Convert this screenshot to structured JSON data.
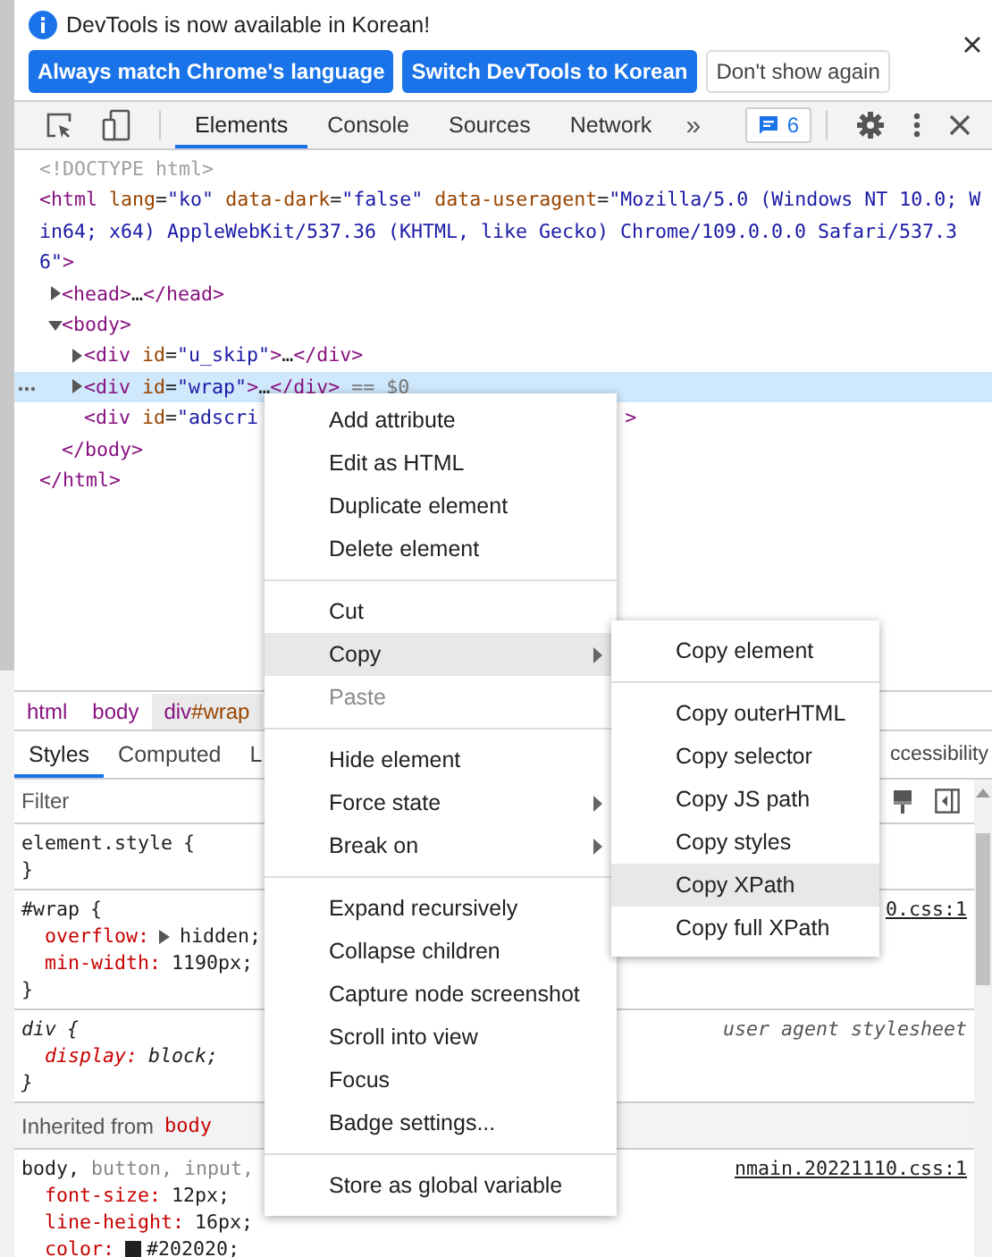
{
  "infobar": {
    "message": "DevTools is now available in Korean!",
    "buttons": [
      {
        "label": "Always match Chrome's language",
        "kind": "primary"
      },
      {
        "label": "Switch DevTools to Korean",
        "kind": "primary"
      },
      {
        "label": "Don't show again",
        "kind": "secondary"
      }
    ]
  },
  "toolbar": {
    "tabs": [
      {
        "label": "Elements",
        "selected": true
      },
      {
        "label": "Console",
        "selected": false
      },
      {
        "label": "Sources",
        "selected": false
      },
      {
        "label": "Network",
        "selected": false
      }
    ],
    "more": "»",
    "issues_count": "6"
  },
  "dom_tree": [
    {
      "open": [
        {
          "kind": "doctype",
          "text": "<!DOCTYPE html>"
        }
      ],
      "selected": false
    },
    {
      "open": [
        {
          "kind": "tag",
          "text": "<html"
        },
        {
          "kind": "attr",
          "text": " lang"
        },
        {
          "kind": "plain",
          "text": "="
        },
        {
          "kind": "value",
          "text": "\"ko\""
        },
        {
          "kind": "attr",
          "text": " data-dark"
        },
        {
          "kind": "plain",
          "text": "="
        },
        {
          "kind": "value",
          "text": "\"false\""
        },
        {
          "kind": "attr",
          "text": " data-useragent"
        },
        {
          "kind": "plain",
          "text": "="
        },
        {
          "kind": "value",
          "text": "\"Mozilla/5.0 (Windows NT 10.0; Win64; x64) AppleWebKit/537.36 (KHTML, like Gecko) Chrome/109.0.0.0 Safari/537.36\""
        },
        {
          "kind": "tag",
          "text": ">"
        }
      ],
      "selected": false,
      "children": [
        {
          "open": [
            {
              "kind": "tag",
              "text": "<head>"
            },
            {
              "kind": "plain",
              "text": "…"
            },
            {
              "kind": "tag",
              "text": "</head>"
            }
          ],
          "expanded": false,
          "selected": false
        },
        {
          "open": [
            {
              "kind": "tag",
              "text": "<body>"
            }
          ],
          "expanded": true,
          "selected": false,
          "children": [
            {
              "open": [
                {
                  "kind": "tag",
                  "text": "<div"
                },
                {
                  "kind": "attr",
                  "text": " id"
                },
                {
                  "kind": "plain",
                  "text": "="
                },
                {
                  "kind": "value",
                  "text": "\"u_skip\""
                },
                {
                  "kind": "tag",
                  "text": ">"
                },
                {
                  "kind": "plain",
                  "text": "…"
                },
                {
                  "kind": "tag",
                  "text": "</div>"
                }
              ],
              "expanded": false,
              "selected": false
            },
            {
              "open": [
                {
                  "kind": "tag",
                  "text": "<div"
                },
                {
                  "kind": "attr",
                  "text": " id"
                },
                {
                  "kind": "plain",
                  "text": "="
                },
                {
                  "kind": "value",
                  "text": "\"wrap\""
                },
                {
                  "kind": "tag",
                  "text": ">"
                },
                {
                  "kind": "plain",
                  "text": "…"
                },
                {
                  "kind": "tag",
                  "text": "</div>"
                },
                {
                  "kind": "muted",
                  "text": " == $0"
                }
              ],
              "expanded": false,
              "selected": true
            },
            {
              "open": [
                {
                  "kind": "tag",
                  "text": "<div"
                },
                {
                  "kind": "attr",
                  "text": " id"
                },
                {
                  "kind": "plain",
                  "text": "="
                },
                {
                  "kind": "value",
                  "text": "\"adscri"
                }
              ],
              "tail": [
                {
                  "kind": "tag",
                  "text": ">"
                }
              ],
              "selected": false
            }
          ],
          "close": [
            {
              "kind": "tag",
              "text": "</body>"
            }
          ]
        }
      ],
      "close": [
        {
          "kind": "tag",
          "text": "</html>"
        }
      ]
    }
  ],
  "breadcrumbs": [
    {
      "tag": "html",
      "selected": false
    },
    {
      "tag": "body",
      "selected": false
    },
    {
      "tag": "div",
      "id": "#wrap",
      "selected": true
    }
  ],
  "styles_pane": {
    "tabs": [
      {
        "label": "Styles",
        "selected": true
      },
      {
        "label": "Computed",
        "selected": false
      },
      {
        "label": "L",
        "selected": false
      },
      {
        "label": "ccessibility",
        "selected": false
      }
    ],
    "filter": {
      "placeholder": "Filter"
    },
    "rules": [
      {
        "kind": "inline",
        "selector": [
          {
            "text": "element.style",
            "matched": true
          }
        ],
        "open": "{",
        "close": "}"
      },
      {
        "kind": "author",
        "selector": [
          {
            "text": "#wrap",
            "matched": true
          }
        ],
        "open": "{",
        "source": "0.css:1",
        "properties": [
          {
            "name": "overflow:",
            "value": "hidden;",
            "expandable": true
          },
          {
            "name": "min-width:",
            "value": "1190px;"
          }
        ],
        "close": "}"
      },
      {
        "kind": "user_agent",
        "selector": [
          {
            "text": "div",
            "matched": true
          }
        ],
        "open": "{",
        "source": "user agent stylesheet",
        "properties": [
          {
            "name": "display:",
            "value": "block;"
          }
        ],
        "close": "}"
      },
      {
        "kind": "inherited_header",
        "label": "Inherited from",
        "element": "body"
      },
      {
        "kind": "author",
        "selector": [
          {
            "text": "body,",
            "matched": true
          },
          {
            "text": "button,",
            "matched": false
          },
          {
            "text": "input,",
            "matched": false
          }
        ],
        "source": "nmain.20221110.css:1",
        "properties": [
          {
            "name": "font-size:",
            "value": "12px;"
          },
          {
            "name": "line-height:",
            "value": "16px;"
          },
          {
            "name": "color:",
            "value": "#202020;",
            "color": "#202020"
          }
        ]
      }
    ]
  },
  "context_menu": {
    "items": [
      {
        "kind": "item",
        "label": "Add attribute",
        "submenu": false,
        "disabled": false,
        "selected": false
      },
      {
        "kind": "item",
        "label": "Edit as HTML",
        "submenu": false,
        "disabled": false,
        "selected": false
      },
      {
        "kind": "item",
        "label": "Duplicate element",
        "submenu": false,
        "disabled": false,
        "selected": false
      },
      {
        "kind": "item",
        "label": "Delete element",
        "submenu": false,
        "disabled": false,
        "selected": false
      },
      {
        "kind": "separator"
      },
      {
        "kind": "item",
        "label": "Cut",
        "submenu": false,
        "disabled": false,
        "selected": false
      },
      {
        "kind": "item",
        "label": "Copy",
        "submenu": true,
        "disabled": false,
        "selected": true
      },
      {
        "kind": "item",
        "label": "Paste",
        "submenu": false,
        "disabled": true,
        "selected": false
      },
      {
        "kind": "separator"
      },
      {
        "kind": "item",
        "label": "Hide element",
        "submenu": false,
        "disabled": false,
        "selected": false
      },
      {
        "kind": "item",
        "label": "Force state",
        "submenu": true,
        "disabled": false,
        "selected": false
      },
      {
        "kind": "item",
        "label": "Break on",
        "submenu": true,
        "disabled": false,
        "selected": false
      },
      {
        "kind": "separator"
      },
      {
        "kind": "item",
        "label": "Expand recursively",
        "submenu": false,
        "disabled": false,
        "selected": false
      },
      {
        "kind": "item",
        "label": "Collapse children",
        "submenu": false,
        "disabled": false,
        "selected": false
      },
      {
        "kind": "item",
        "label": "Capture node screenshot",
        "submenu": false,
        "disabled": false,
        "selected": false
      },
      {
        "kind": "item",
        "label": "Scroll into view",
        "submenu": false,
        "disabled": false,
        "selected": false
      },
      {
        "kind": "item",
        "label": "Focus",
        "submenu": false,
        "disabled": false,
        "selected": false
      },
      {
        "kind": "item",
        "label": "Badge settings...",
        "submenu": false,
        "disabled": false,
        "selected": false
      },
      {
        "kind": "separator"
      },
      {
        "kind": "item",
        "label": "Store as global variable",
        "submenu": false,
        "disabled": false,
        "selected": false
      }
    ]
  },
  "submenu": {
    "items": [
      {
        "kind": "item",
        "label": "Copy element",
        "disabled": false,
        "selected": false
      },
      {
        "kind": "separator"
      },
      {
        "kind": "item",
        "label": "Copy outerHTML",
        "disabled": false,
        "selected": false
      },
      {
        "kind": "item",
        "label": "Copy selector",
        "disabled": false,
        "selected": false
      },
      {
        "kind": "item",
        "label": "Copy JS path",
        "disabled": false,
        "selected": false
      },
      {
        "kind": "item",
        "label": "Copy styles",
        "disabled": false,
        "selected": false
      },
      {
        "kind": "item",
        "label": "Copy XPath",
        "disabled": false,
        "selected": true
      },
      {
        "kind": "item",
        "label": "Copy full XPath",
        "disabled": false,
        "selected": false
      }
    ]
  }
}
